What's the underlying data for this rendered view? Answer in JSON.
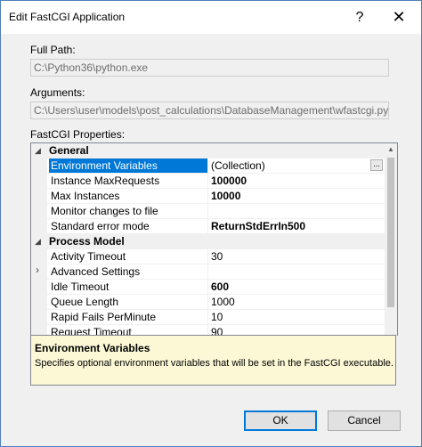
{
  "window": {
    "title": "Edit FastCGI Application",
    "help_glyph": "?",
    "close_glyph": "✕"
  },
  "full_path": {
    "label": "Full Path:",
    "value": "C:\\Python36\\python.exe"
  },
  "arguments": {
    "label": "Arguments:",
    "value": "C:\\Users\\user\\models\\post_calculations\\DatabaseManagement\\wfastcgi.py"
  },
  "properties": {
    "label": "FastCGI Properties:",
    "expanded_glyph": "◢",
    "collapsed_glyph": "›",
    "ellipsis": "...",
    "categories": [
      {
        "name": "General",
        "rows": [
          {
            "name": "Environment Variables",
            "value": "(Collection)",
            "bold": false,
            "selected": true
          },
          {
            "name": "Instance MaxRequests",
            "value": "100000",
            "bold": true
          },
          {
            "name": "Max Instances",
            "value": "10000",
            "bold": true
          },
          {
            "name": "Monitor changes to file",
            "value": "",
            "bold": false
          },
          {
            "name": "Standard error mode",
            "value": "ReturnStdErrIn500",
            "bold": true
          }
        ]
      },
      {
        "name": "Process Model",
        "rows": [
          {
            "name": "Activity Timeout",
            "value": "30",
            "bold": false
          },
          {
            "name": "Advanced Settings",
            "value": "",
            "bold": false,
            "expandable": true
          },
          {
            "name": "Idle Timeout",
            "value": "600",
            "bold": true
          },
          {
            "name": "Queue Length",
            "value": "1000",
            "bold": false
          },
          {
            "name": "Rapid Fails PerMinute",
            "value": "10",
            "bold": false
          },
          {
            "name": "Request Timeout",
            "value": "90",
            "bold": false
          }
        ]
      }
    ]
  },
  "description": {
    "title": "Environment Variables",
    "text": "Specifies optional environment variables that will be set in the FastCGI executable."
  },
  "buttons": {
    "ok": "OK",
    "cancel": "Cancel"
  }
}
